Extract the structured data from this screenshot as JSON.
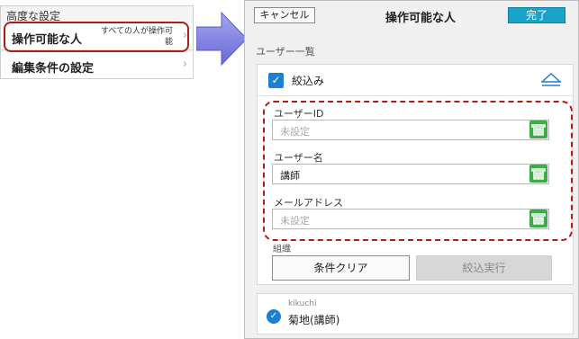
{
  "left_panel": {
    "title": "高度な設定",
    "rows": [
      {
        "label": "操作可能な人",
        "value": "すべての人が操作可能"
      },
      {
        "label": "編集条件の設定",
        "value": ""
      }
    ]
  },
  "screen": {
    "cancel_label": "キャンセル",
    "title": "操作可能な人",
    "done_label": "完了",
    "list_heading": "ユーザー一覧",
    "filter": {
      "label": "絞込み",
      "fields": [
        {
          "label": "ユーザーID",
          "value": "",
          "placeholder": "未設定"
        },
        {
          "label": "ユーザー名",
          "value": "講師",
          "placeholder": ""
        },
        {
          "label": "メールアドレス",
          "value": "",
          "placeholder": "未設定"
        }
      ],
      "sort_label": "組織",
      "clear_label": "条件クリア",
      "run_label": "絞込実行"
    },
    "user": {
      "id": "kikuchi",
      "name": "菊地(講師)"
    }
  },
  "colors": {
    "accent": "#19a3c7",
    "check": "#1b7fd4",
    "highlight": "#b01c1c",
    "field_icon": "#3cae47"
  }
}
